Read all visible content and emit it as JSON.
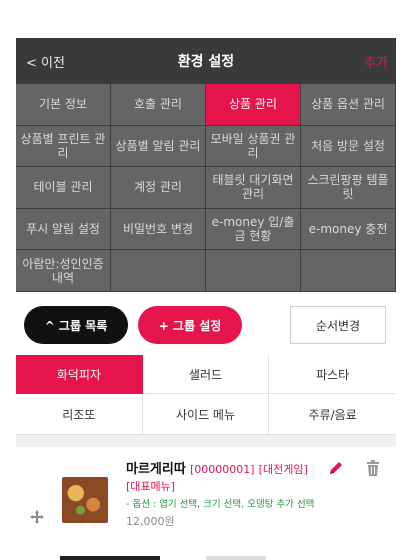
{
  "header": {
    "back_label": "< 이전",
    "title": "환경 설정",
    "add_label": "추가"
  },
  "menu": [
    {
      "label": "기본 정보",
      "active": false
    },
    {
      "label": "호출 관리",
      "active": false
    },
    {
      "label": "상품 관리",
      "active": true
    },
    {
      "label": "상품 옵션 관리",
      "active": false
    },
    {
      "label": "상품별 프린트 관리",
      "active": false
    },
    {
      "label": "상품별 알림 관리",
      "active": false
    },
    {
      "label": "모바일 상품권 관리",
      "active": false
    },
    {
      "label": "처음 방문 설정",
      "active": false
    },
    {
      "label": "테이블 관리",
      "active": false
    },
    {
      "label": "계정 관리",
      "active": false
    },
    {
      "label": "태블릿 대기화면 관리",
      "active": false
    },
    {
      "label": "스크린팡팡 템플릿",
      "active": false
    },
    {
      "label": "푸시 알림 설정",
      "active": false
    },
    {
      "label": "비밀번호 변경",
      "active": false
    },
    {
      "label": "e-money 입/출금 현황",
      "active": false
    },
    {
      "label": "e-money 충전",
      "active": false
    },
    {
      "label": "아람만:성인인증 내역",
      "active": false
    },
    {
      "label": "",
      "active": false
    },
    {
      "label": "",
      "active": false
    },
    {
      "label": "",
      "active": false
    }
  ],
  "buttons": {
    "group_list": "^ 그룹 목록",
    "group_settings": "+ 그룹 설정",
    "reorder": "순서변경"
  },
  "tabs": [
    {
      "label": "화덕피자",
      "active": true
    },
    {
      "label": "샐러드",
      "active": false
    },
    {
      "label": "파스타",
      "active": false
    },
    {
      "label": "리조또",
      "active": false
    },
    {
      "label": "사이드 메뉴",
      "active": false
    },
    {
      "label": "주류/음료",
      "active": false
    }
  ],
  "product": {
    "name": "마르게리따",
    "code": "[00000001]",
    "category": "[대전게임]",
    "badge": "[대표메뉴]",
    "options": "- 옵션 : 엽기 선택, 크기 선택, 오뎅탕 추가 선택",
    "price": "12,000원"
  },
  "colors": {
    "accent": "#e5154c",
    "header_bg": "#3a3a3a",
    "menu_bg": "#656565",
    "option_text": "#1e9a3a"
  },
  "icons": {
    "edit": "pencil-icon",
    "delete": "trash-icon",
    "drag": "move-icon"
  }
}
